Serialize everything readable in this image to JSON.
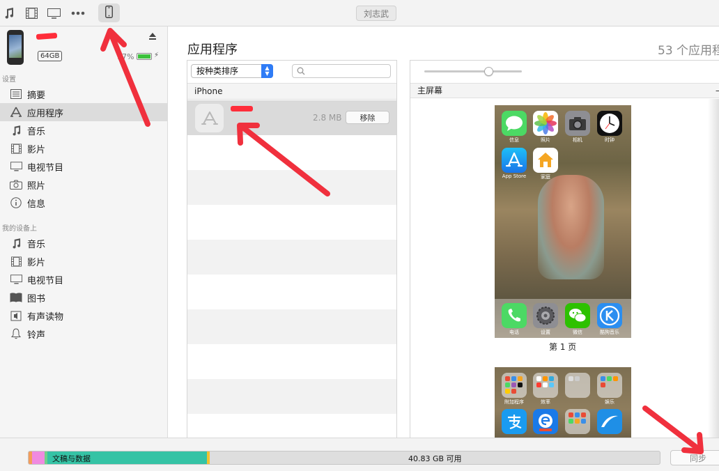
{
  "toolbar": {
    "icons": [
      "music-icon",
      "film-icon",
      "tv-icon",
      "more-icon",
      "phone-icon"
    ],
    "account_label": "刘志武"
  },
  "device": {
    "capacity": "64GB",
    "battery_text": "97%"
  },
  "sidebar": {
    "settings_label": "设置",
    "settings_items": [
      {
        "label": "摘要",
        "icon": "summary-icon"
      },
      {
        "label": "应用程序",
        "icon": "apps-icon"
      },
      {
        "label": "音乐",
        "icon": "music-icon"
      },
      {
        "label": "影片",
        "icon": "film-icon"
      },
      {
        "label": "电视节目",
        "icon": "tv-icon"
      },
      {
        "label": "照片",
        "icon": "camera-icon"
      },
      {
        "label": "信息",
        "icon": "info-icon"
      }
    ],
    "ondevice_label": "我的设备上",
    "ondevice_items": [
      {
        "label": "音乐",
        "icon": "music-icon"
      },
      {
        "label": "影片",
        "icon": "film-icon"
      },
      {
        "label": "电视节目",
        "icon": "tv-icon"
      },
      {
        "label": "图书",
        "icon": "book-icon"
      },
      {
        "label": "有声读物",
        "icon": "audiobook-icon"
      },
      {
        "label": "铃声",
        "icon": "bell-icon"
      }
    ]
  },
  "main": {
    "title": "应用程序",
    "count": "53 个应用程",
    "sort_label": "按种类排序",
    "search_placeholder": "",
    "list_header": "iPhone",
    "app": {
      "size": "2.8 MB",
      "remove_label": "移除"
    },
    "screens_header": "主屏幕",
    "screens_dash": "–",
    "page1": {
      "label": "第 1 页",
      "apps": [
        "信息",
        "照片",
        "相机",
        "时钟",
        "App Store",
        "家庭"
      ],
      "dock": [
        "电话",
        "设置",
        "微信",
        "酷狗音乐"
      ]
    },
    "page2": {
      "folders": [
        "附加程序",
        "效率",
        "",
        "娱乐"
      ],
      "apps": [
        "支付宝",
        "",
        "",
        ""
      ]
    }
  },
  "storage": {
    "docs_label": "文稿与数据",
    "free_label": "40.83 GB 可用",
    "segments": [
      {
        "name": "audio",
        "fraction": 0.005,
        "color": "#f39c5a"
      },
      {
        "name": "photos",
        "fraction": 0.02,
        "color": "#f08ae0"
      },
      {
        "name": "apps",
        "fraction": 0.004,
        "color": "#6fd089"
      },
      {
        "name": "docs",
        "fraction": 0.253,
        "color": "#35c3a5"
      },
      {
        "name": "other",
        "fraction": 0.004,
        "color": "#f1c232"
      }
    ]
  },
  "sync_label": "同步",
  "colors": {
    "accent": "#2f7cf6",
    "annotation_arrow": "#f0303d",
    "battery": "#3cc23c"
  }
}
